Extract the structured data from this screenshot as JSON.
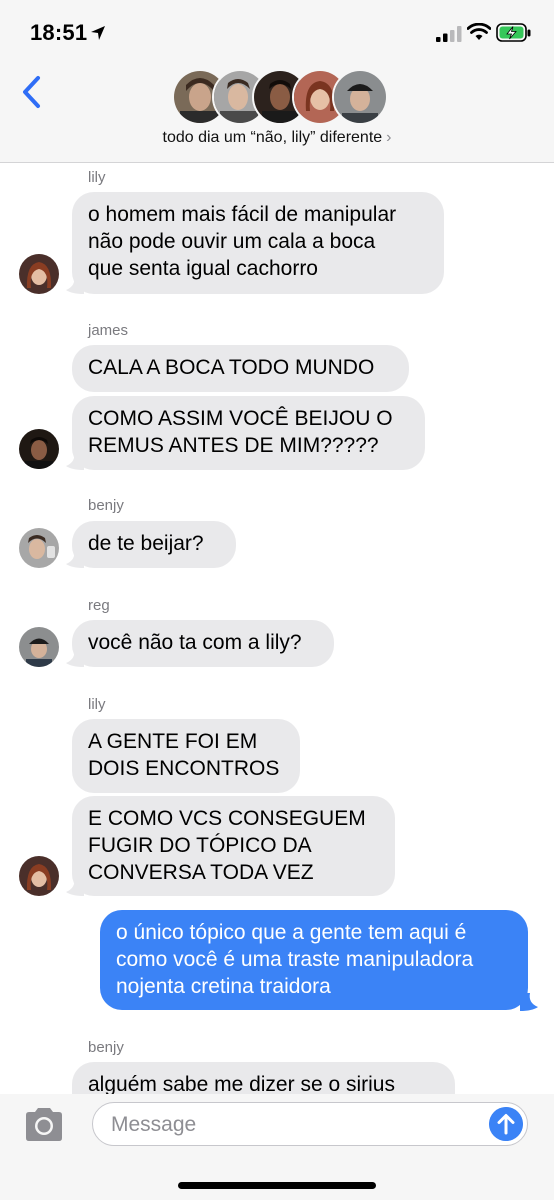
{
  "status_bar": {
    "time": "18:51"
  },
  "header": {
    "back_icon": "chevron-left-icon",
    "group_name": "todo dia um “não, lily” diferente",
    "chevron": "›",
    "avatars": [
      {
        "name": "member-1",
        "color": "#7a6a58"
      },
      {
        "name": "member-2",
        "color": "#8f8f8f"
      },
      {
        "name": "member-3",
        "color": "#3d2f28"
      },
      {
        "name": "member-4",
        "color": "#a25a4a"
      },
      {
        "name": "member-5",
        "color": "#6b6e6f"
      }
    ]
  },
  "messages": [
    {
      "sender": "lily",
      "bubbles": [
        "o homem mais fácil de manipular\nnão pode ouvir um cala a boca\nque senta igual cachorro"
      ]
    },
    {
      "sender": "james",
      "bubbles": [
        "CALA A BOCA TODO MUNDO",
        "COMO ASSIM VOCÊ BEIJOU O\nREMUS ANTES DE MIM?????"
      ]
    },
    {
      "sender": "benjy",
      "bubbles": [
        "de te beijar?"
      ]
    },
    {
      "sender": "reg",
      "bubbles": [
        "você não ta com a lily?"
      ]
    },
    {
      "sender": "lily",
      "bubbles": [
        "A GENTE FOI EM\nDOIS ENCONTROS",
        "E COMO VCS CONSEGUEM\nFUGIR DO TÓPICO DA\nCONVERSA TODA VEZ"
      ]
    },
    {
      "sender": "",
      "outgoing": true,
      "bubbles": [
        "o único tópico que a gente tem aqui é\ncomo você é uma traste manipuladora\nnojenta cretina traidora"
      ]
    },
    {
      "sender": "benjy",
      "bubbles": [
        "alguém sabe me dizer se o sirius"
      ]
    }
  ],
  "input": {
    "placeholder": "Message",
    "camera_icon": "camera-icon",
    "send_icon": "arrow-up-icon"
  },
  "colors": {
    "accent": "#3b83f6",
    "incoming_bubble": "#e9e9eb",
    "battery_green": "#35c759"
  }
}
